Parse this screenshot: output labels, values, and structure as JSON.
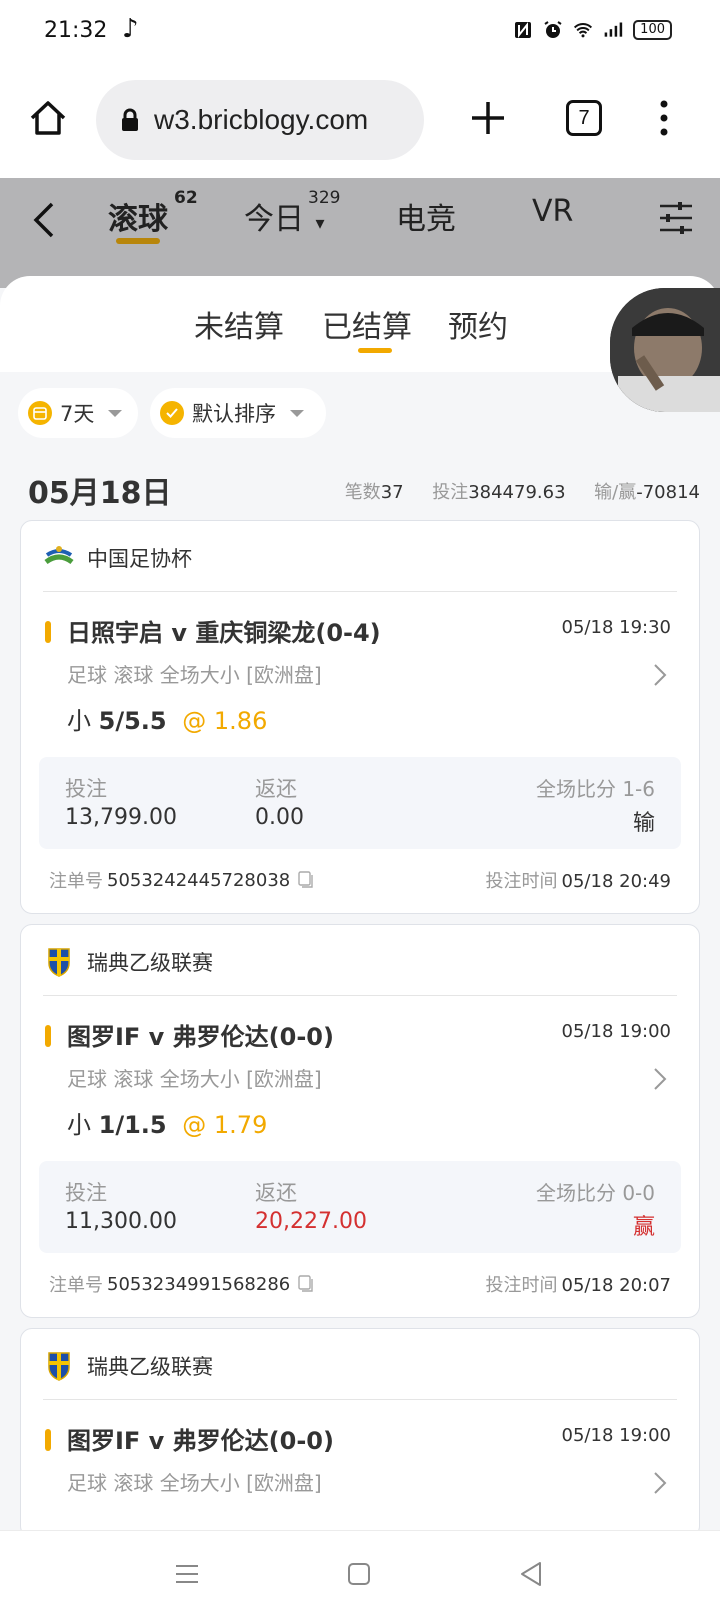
{
  "status": {
    "time": "21:32",
    "note": "♪",
    "battery": "100"
  },
  "browser": {
    "url": "w3.bricblogy.com",
    "tab_count": "7"
  },
  "app_nav": {
    "tabs": [
      {
        "label": "滚球",
        "badge": "62"
      },
      {
        "label": "今日",
        "badge": "329"
      },
      {
        "label": "电竞",
        "badge": ""
      },
      {
        "label": "VR",
        "badge": ""
      }
    ]
  },
  "sub_tabs": [
    "未结算",
    "已结算",
    "预约"
  ],
  "filters": {
    "period": "7天",
    "sort": "默认排序"
  },
  "summary": {
    "date": "05月18日",
    "count_label": "笔数",
    "count": "37",
    "stake_label": "投注",
    "stake": "384479.63",
    "pl_label": "输/赢",
    "pl": "-70814"
  },
  "bets": [
    {
      "league": "中国足协杯",
      "match": "日照宇启 v 重庆铜梁龙(0-4)",
      "time": "05/18 19:30",
      "market": "足球 滚球   全场大小 [欧洲盘]",
      "pick_prefix": "小",
      "pick_line": "5/5.5",
      "odds": "@ 1.86",
      "stake_label": "投注",
      "stake": "13,799.00",
      "return_label": "返还",
      "return": "0.00",
      "score": "全场比分 1-6",
      "result": "输",
      "ticket_label": "注单号",
      "ticket": "5053242445728038",
      "bet_time_label": "投注时间",
      "bet_time": "05/18 20:49"
    },
    {
      "league": "瑞典乙级联赛",
      "match": "图罗IF v 弗罗伦达(0-0)",
      "time": "05/18 19:00",
      "market": "足球 滚球   全场大小 [欧洲盘]",
      "pick_prefix": "小",
      "pick_line": "1/1.5",
      "odds": "@ 1.79",
      "stake_label": "投注",
      "stake": "11,300.00",
      "return_label": "返还",
      "return": "20,227.00",
      "score": "全场比分 0-0",
      "result": "赢",
      "ticket_label": "注单号",
      "ticket": "5053234991568286",
      "bet_time_label": "投注时间",
      "bet_time": "05/18 20:07"
    },
    {
      "league": "瑞典乙级联赛",
      "match": "图罗IF v 弗罗伦达(0-0)",
      "time": "05/18 19:00",
      "market": "足球 滚球   全场大小 [欧洲盘]"
    }
  ],
  "colors": {
    "accent": "#f2a900",
    "loss": "#333333",
    "win": "#d43030",
    "header_bg": "#b4b4b6"
  }
}
